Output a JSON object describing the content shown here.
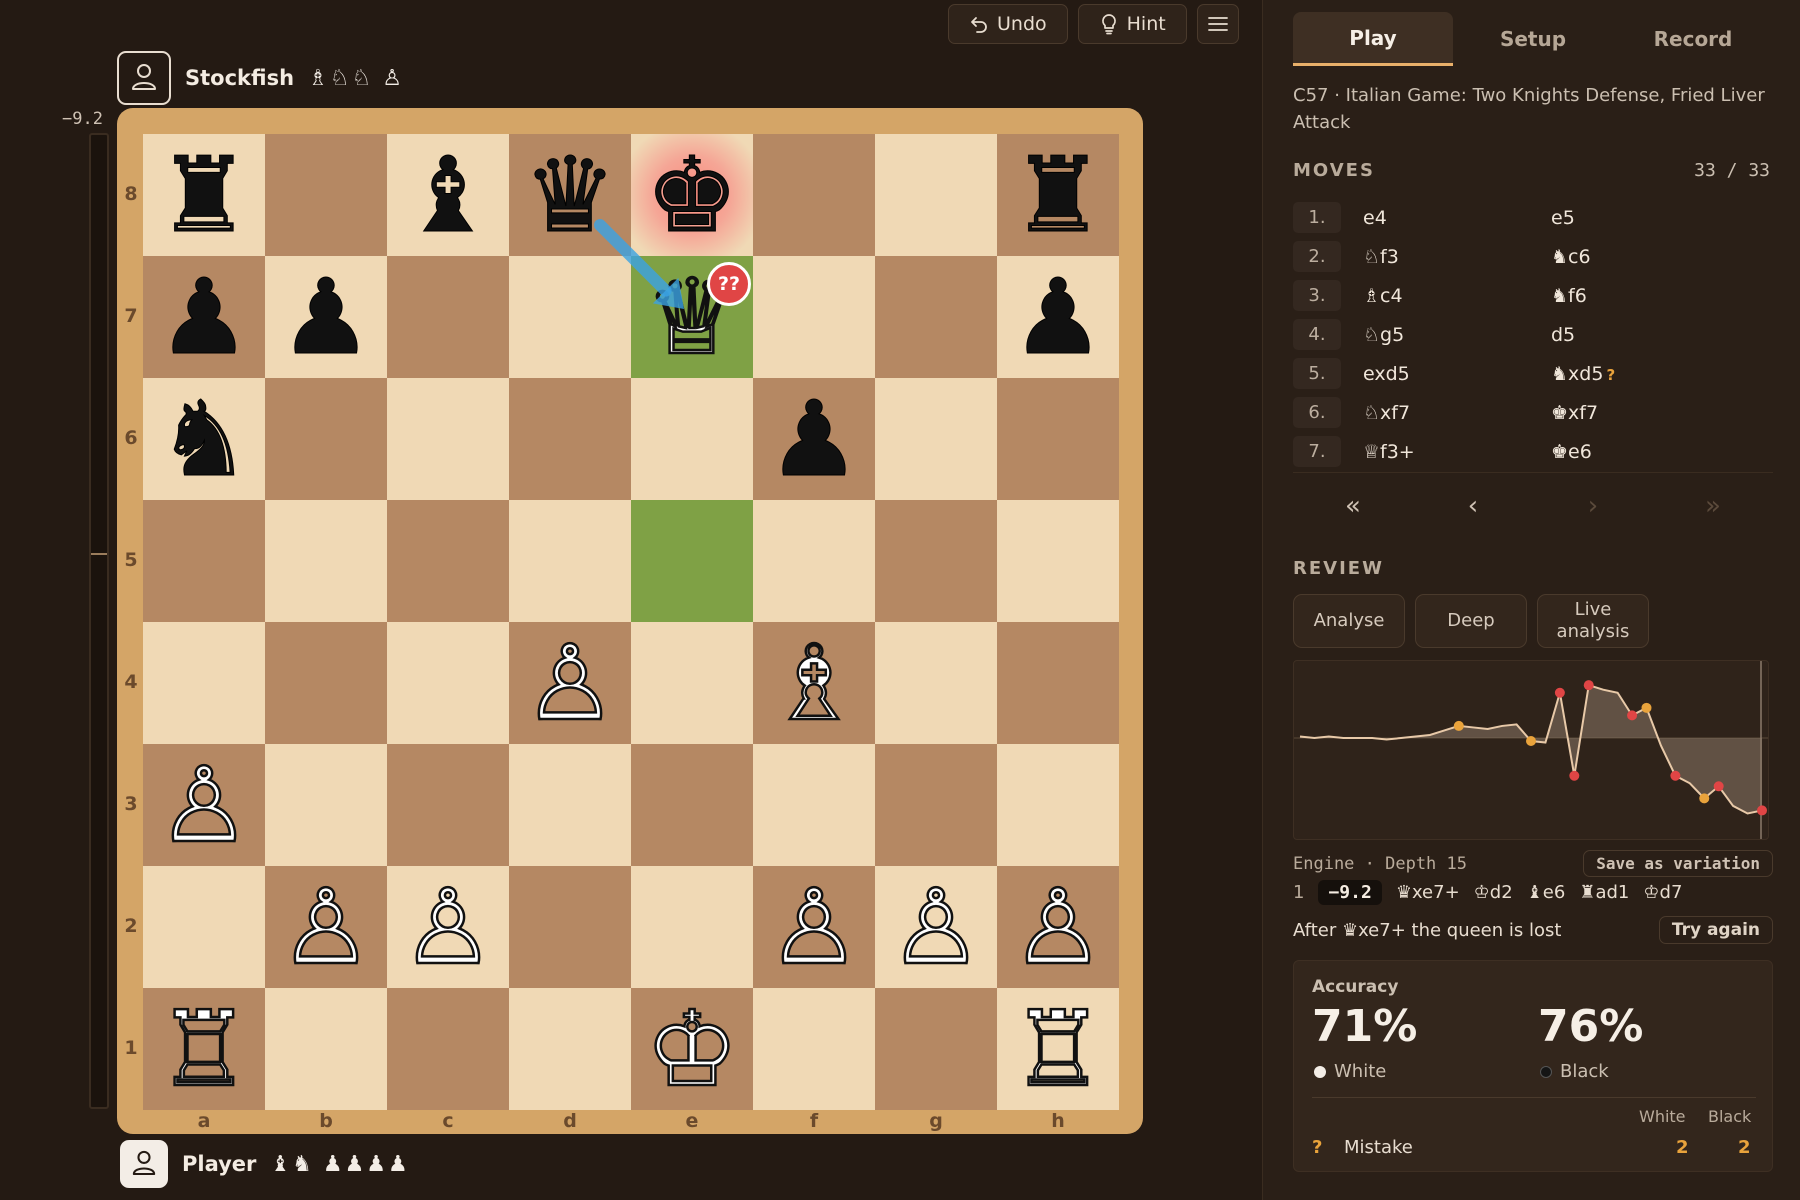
{
  "toolbar": {
    "undo_label": "Undo",
    "hint_label": "Hint"
  },
  "players": {
    "top": {
      "name": "Stockfish",
      "captured": "♗♘♘ ♙"
    },
    "bottom": {
      "name": "Player",
      "captured": "♝♞ ♟♟♟♟"
    }
  },
  "eval_bar": {
    "value_text": "−9.2",
    "white_fraction": 0.57
  },
  "board": {
    "ranks": [
      "8",
      "7",
      "6",
      "5",
      "4",
      "3",
      "2",
      "1"
    ],
    "files": [
      "a",
      "b",
      "c",
      "d",
      "e",
      "f",
      "g",
      "h"
    ],
    "squares": [
      [
        "♜",
        "",
        "♝",
        "♛",
        "♚",
        "",
        "",
        "♜"
      ],
      [
        "♟",
        "♟",
        "",
        "",
        "♕",
        "",
        "",
        "♟"
      ],
      [
        "♞",
        "",
        "",
        "",
        "",
        "♟",
        "",
        ""
      ],
      [
        "",
        "",
        "",
        "",
        "",
        "",
        "",
        ""
      ],
      [
        "",
        "",
        "",
        "♙",
        "",
        "♗",
        "",
        ""
      ],
      [
        "♙",
        "",
        "",
        "",
        "",
        "",
        "",
        ""
      ],
      [
        "",
        "♙",
        "♙",
        "",
        "",
        "♙",
        "♙",
        "♙"
      ],
      [
        "♖",
        "",
        "",
        "",
        "♔",
        "",
        "",
        "♖"
      ]
    ],
    "colors": [
      [
        "b",
        "",
        "b",
        "b",
        "b",
        "",
        "",
        "b"
      ],
      [
        "b",
        "b",
        "",
        "",
        "w",
        "",
        "",
        "b"
      ],
      [
        "b",
        "",
        "",
        "",
        "",
        "b",
        "",
        ""
      ],
      [
        "",
        "",
        "",
        "",
        "",
        "",
        "",
        ""
      ],
      [
        "",
        "",
        "",
        "w",
        "",
        "w",
        "",
        ""
      ],
      [
        "w",
        "",
        "",
        "",
        "",
        "",
        "",
        ""
      ],
      [
        "",
        "w",
        "w",
        "",
        "",
        "w",
        "w",
        "w"
      ],
      [
        "w",
        "",
        "",
        "",
        "w",
        "",
        "",
        "w"
      ]
    ],
    "last_move": [
      "e5",
      "e7"
    ],
    "check_square": "e8",
    "blunder_square": "e7",
    "blunder_badge": "??",
    "arrow": {
      "from": "d8",
      "to": "e7",
      "color": "#3ba3e3"
    }
  },
  "panel": {
    "tabs": [
      "Play",
      "Setup",
      "Record"
    ],
    "active_tab": "Play",
    "opening": "C57 · Italian Game: Two Knights Defense, Fried Liver Attack",
    "moves_header": "MOVES",
    "move_count": "33 / 33",
    "moves": [
      {
        "num": "1.",
        "white": "e4",
        "black": "e5",
        "black_mark": ""
      },
      {
        "num": "2.",
        "white": "♘f3",
        "black": "♞c6",
        "black_mark": ""
      },
      {
        "num": "3.",
        "white": "♗c4",
        "black": "♞f6",
        "black_mark": ""
      },
      {
        "num": "4.",
        "white": "♘g5",
        "black": "d5",
        "black_mark": ""
      },
      {
        "num": "5.",
        "white": "exd5",
        "black": "♞xd5",
        "black_mark": "?"
      },
      {
        "num": "6.",
        "white": "♘xf7",
        "black": "♚xf7",
        "black_mark": ""
      },
      {
        "num": "7.",
        "white": "♕f3+",
        "black": "♚e6",
        "black_mark": ""
      }
    ],
    "nav": {
      "first": "«",
      "prev": "‹",
      "next": "›",
      "last": "»"
    },
    "review_header": "REVIEW",
    "review_buttons": [
      "Analyse",
      "Deep",
      "Live analysis"
    ],
    "engine_label": "Engine · Depth 15",
    "save_variation": "Save as variation",
    "pv_index": "1",
    "pv_score": "−9.2",
    "pv_moves": [
      "♛xe7+",
      "♔d2",
      "♝e6",
      "♜ad1",
      "♔d7"
    ],
    "lost_text": "After ♛xe7+ the queen is lost",
    "try_again": "Try again",
    "accuracy": {
      "title": "Accuracy",
      "white_value": "71%",
      "black_value": "76%",
      "white_label": "White",
      "black_label": "Black",
      "col_white": "White",
      "col_black": "Black",
      "mistake_icon": "?",
      "mistake_label": "Mistake",
      "mistake_white": "2",
      "mistake_black": "2"
    }
  },
  "colors": {
    "move_highlight": "#7fa145",
    "check_highlight": "#f98a7d",
    "blunder": "#e04545",
    "mistake": "#e9a33c",
    "graph_line": "#e8c9a8"
  },
  "eval_graph": {
    "values": [
      0.1,
      0.0,
      0.1,
      0.0,
      0.0,
      0.0,
      -0.1,
      0.0,
      0.1,
      0.2,
      0.5,
      0.8,
      0.7,
      0.6,
      0.8,
      0.9,
      -0.2,
      -0.3,
      3.0,
      -2.5,
      3.5,
      3.2,
      3.0,
      1.5,
      2.0,
      -0.5,
      -2.5,
      -3.0,
      -4.0,
      -3.2,
      -4.5,
      -5.0,
      -4.8
    ],
    "markers": [
      {
        "i": 11,
        "kind": "mistake"
      },
      {
        "i": 16,
        "kind": "mistake"
      },
      {
        "i": 18,
        "kind": "blunder"
      },
      {
        "i": 19,
        "kind": "blunder"
      },
      {
        "i": 20,
        "kind": "blunder"
      },
      {
        "i": 23,
        "kind": "blunder"
      },
      {
        "i": 24,
        "kind": "mistake"
      },
      {
        "i": 26,
        "kind": "blunder"
      },
      {
        "i": 28,
        "kind": "mistake"
      },
      {
        "i": 29,
        "kind": "blunder"
      },
      {
        "i": 32,
        "kind": "blunder"
      }
    ]
  }
}
